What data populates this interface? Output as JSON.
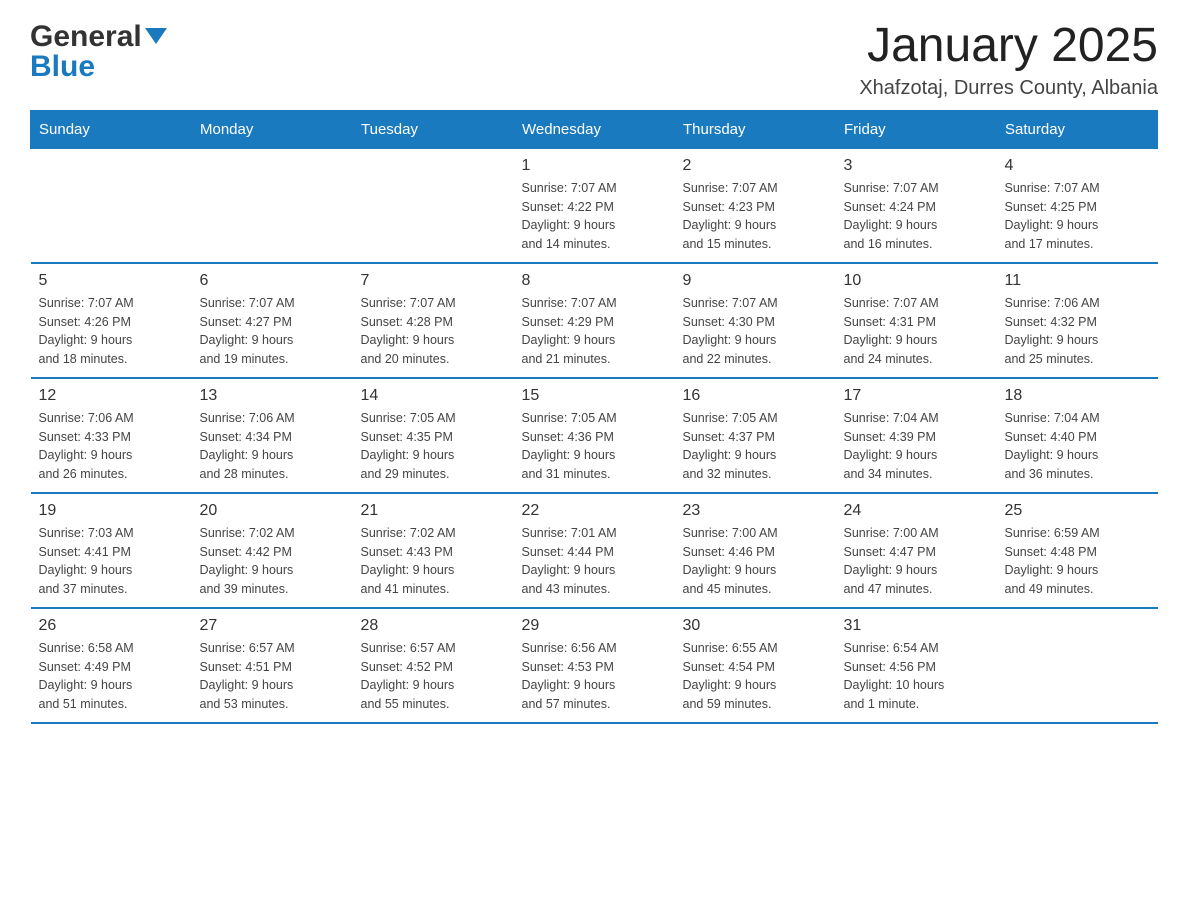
{
  "header": {
    "logo_general": "General",
    "logo_blue": "Blue",
    "title": "January 2025",
    "subtitle": "Xhafzotaj, Durres County, Albania"
  },
  "calendar": {
    "days_of_week": [
      "Sunday",
      "Monday",
      "Tuesday",
      "Wednesday",
      "Thursday",
      "Friday",
      "Saturday"
    ],
    "weeks": [
      [
        {
          "day": "",
          "info": ""
        },
        {
          "day": "",
          "info": ""
        },
        {
          "day": "",
          "info": ""
        },
        {
          "day": "1",
          "info": "Sunrise: 7:07 AM\nSunset: 4:22 PM\nDaylight: 9 hours\nand 14 minutes."
        },
        {
          "day": "2",
          "info": "Sunrise: 7:07 AM\nSunset: 4:23 PM\nDaylight: 9 hours\nand 15 minutes."
        },
        {
          "day": "3",
          "info": "Sunrise: 7:07 AM\nSunset: 4:24 PM\nDaylight: 9 hours\nand 16 minutes."
        },
        {
          "day": "4",
          "info": "Sunrise: 7:07 AM\nSunset: 4:25 PM\nDaylight: 9 hours\nand 17 minutes."
        }
      ],
      [
        {
          "day": "5",
          "info": "Sunrise: 7:07 AM\nSunset: 4:26 PM\nDaylight: 9 hours\nand 18 minutes."
        },
        {
          "day": "6",
          "info": "Sunrise: 7:07 AM\nSunset: 4:27 PM\nDaylight: 9 hours\nand 19 minutes."
        },
        {
          "day": "7",
          "info": "Sunrise: 7:07 AM\nSunset: 4:28 PM\nDaylight: 9 hours\nand 20 minutes."
        },
        {
          "day": "8",
          "info": "Sunrise: 7:07 AM\nSunset: 4:29 PM\nDaylight: 9 hours\nand 21 minutes."
        },
        {
          "day": "9",
          "info": "Sunrise: 7:07 AM\nSunset: 4:30 PM\nDaylight: 9 hours\nand 22 minutes."
        },
        {
          "day": "10",
          "info": "Sunrise: 7:07 AM\nSunset: 4:31 PM\nDaylight: 9 hours\nand 24 minutes."
        },
        {
          "day": "11",
          "info": "Sunrise: 7:06 AM\nSunset: 4:32 PM\nDaylight: 9 hours\nand 25 minutes."
        }
      ],
      [
        {
          "day": "12",
          "info": "Sunrise: 7:06 AM\nSunset: 4:33 PM\nDaylight: 9 hours\nand 26 minutes."
        },
        {
          "day": "13",
          "info": "Sunrise: 7:06 AM\nSunset: 4:34 PM\nDaylight: 9 hours\nand 28 minutes."
        },
        {
          "day": "14",
          "info": "Sunrise: 7:05 AM\nSunset: 4:35 PM\nDaylight: 9 hours\nand 29 minutes."
        },
        {
          "day": "15",
          "info": "Sunrise: 7:05 AM\nSunset: 4:36 PM\nDaylight: 9 hours\nand 31 minutes."
        },
        {
          "day": "16",
          "info": "Sunrise: 7:05 AM\nSunset: 4:37 PM\nDaylight: 9 hours\nand 32 minutes."
        },
        {
          "day": "17",
          "info": "Sunrise: 7:04 AM\nSunset: 4:39 PM\nDaylight: 9 hours\nand 34 minutes."
        },
        {
          "day": "18",
          "info": "Sunrise: 7:04 AM\nSunset: 4:40 PM\nDaylight: 9 hours\nand 36 minutes."
        }
      ],
      [
        {
          "day": "19",
          "info": "Sunrise: 7:03 AM\nSunset: 4:41 PM\nDaylight: 9 hours\nand 37 minutes."
        },
        {
          "day": "20",
          "info": "Sunrise: 7:02 AM\nSunset: 4:42 PM\nDaylight: 9 hours\nand 39 minutes."
        },
        {
          "day": "21",
          "info": "Sunrise: 7:02 AM\nSunset: 4:43 PM\nDaylight: 9 hours\nand 41 minutes."
        },
        {
          "day": "22",
          "info": "Sunrise: 7:01 AM\nSunset: 4:44 PM\nDaylight: 9 hours\nand 43 minutes."
        },
        {
          "day": "23",
          "info": "Sunrise: 7:00 AM\nSunset: 4:46 PM\nDaylight: 9 hours\nand 45 minutes."
        },
        {
          "day": "24",
          "info": "Sunrise: 7:00 AM\nSunset: 4:47 PM\nDaylight: 9 hours\nand 47 minutes."
        },
        {
          "day": "25",
          "info": "Sunrise: 6:59 AM\nSunset: 4:48 PM\nDaylight: 9 hours\nand 49 minutes."
        }
      ],
      [
        {
          "day": "26",
          "info": "Sunrise: 6:58 AM\nSunset: 4:49 PM\nDaylight: 9 hours\nand 51 minutes."
        },
        {
          "day": "27",
          "info": "Sunrise: 6:57 AM\nSunset: 4:51 PM\nDaylight: 9 hours\nand 53 minutes."
        },
        {
          "day": "28",
          "info": "Sunrise: 6:57 AM\nSunset: 4:52 PM\nDaylight: 9 hours\nand 55 minutes."
        },
        {
          "day": "29",
          "info": "Sunrise: 6:56 AM\nSunset: 4:53 PM\nDaylight: 9 hours\nand 57 minutes."
        },
        {
          "day": "30",
          "info": "Sunrise: 6:55 AM\nSunset: 4:54 PM\nDaylight: 9 hours\nand 59 minutes."
        },
        {
          "day": "31",
          "info": "Sunrise: 6:54 AM\nSunset: 4:56 PM\nDaylight: 10 hours\nand 1 minute."
        },
        {
          "day": "",
          "info": ""
        }
      ]
    ]
  }
}
